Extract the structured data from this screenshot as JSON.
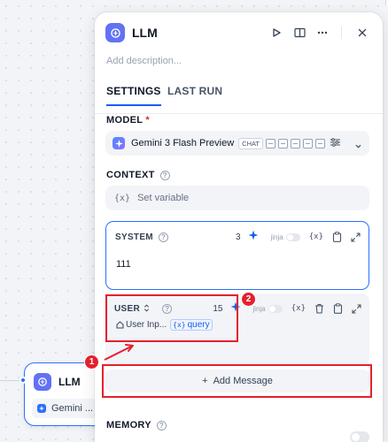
{
  "background_node": {
    "title": "LLM",
    "model_label": "Gemini ..."
  },
  "panel": {
    "title": "LLM",
    "description_placeholder": "Add description...",
    "tabs": [
      "SETTINGS",
      "LAST RUN"
    ],
    "model": {
      "label": "MODEL",
      "required_mark": "*",
      "name": "Gemini 3 Flash Preview",
      "mode_tag": "CHAT"
    },
    "context": {
      "label": "CONTEXT",
      "placeholder": "Set variable",
      "var_symbol": "{x}"
    },
    "system": {
      "role": "SYSTEM",
      "tokens": "3",
      "jinja_label": "jinja",
      "var_symbol": "{x}",
      "text": "111"
    },
    "user": {
      "role": "USER",
      "tokens": "15",
      "jinja_label": "jinja",
      "var_symbol": "{x}",
      "source": "User Inp...",
      "variable_prefix": "{x}",
      "variable": "query"
    },
    "add_message": {
      "plus": "+",
      "label": "Add Message"
    },
    "memory": {
      "label": "MEMORY"
    }
  },
  "annotations": {
    "badge_1": "1",
    "badge_2": "2",
    "color": "#e5202e"
  },
  "colors": {
    "accent": "#155eef",
    "logo": "#6172f3",
    "highlight": "#e5202e"
  },
  "icons": [
    "play-icon",
    "book-icon",
    "more-icon",
    "close-icon",
    "help-icon",
    "sparkle-icon",
    "clipboard-icon",
    "expand-icon",
    "trash-icon",
    "chevron-down-icon",
    "tune-icon",
    "home-icon"
  ]
}
